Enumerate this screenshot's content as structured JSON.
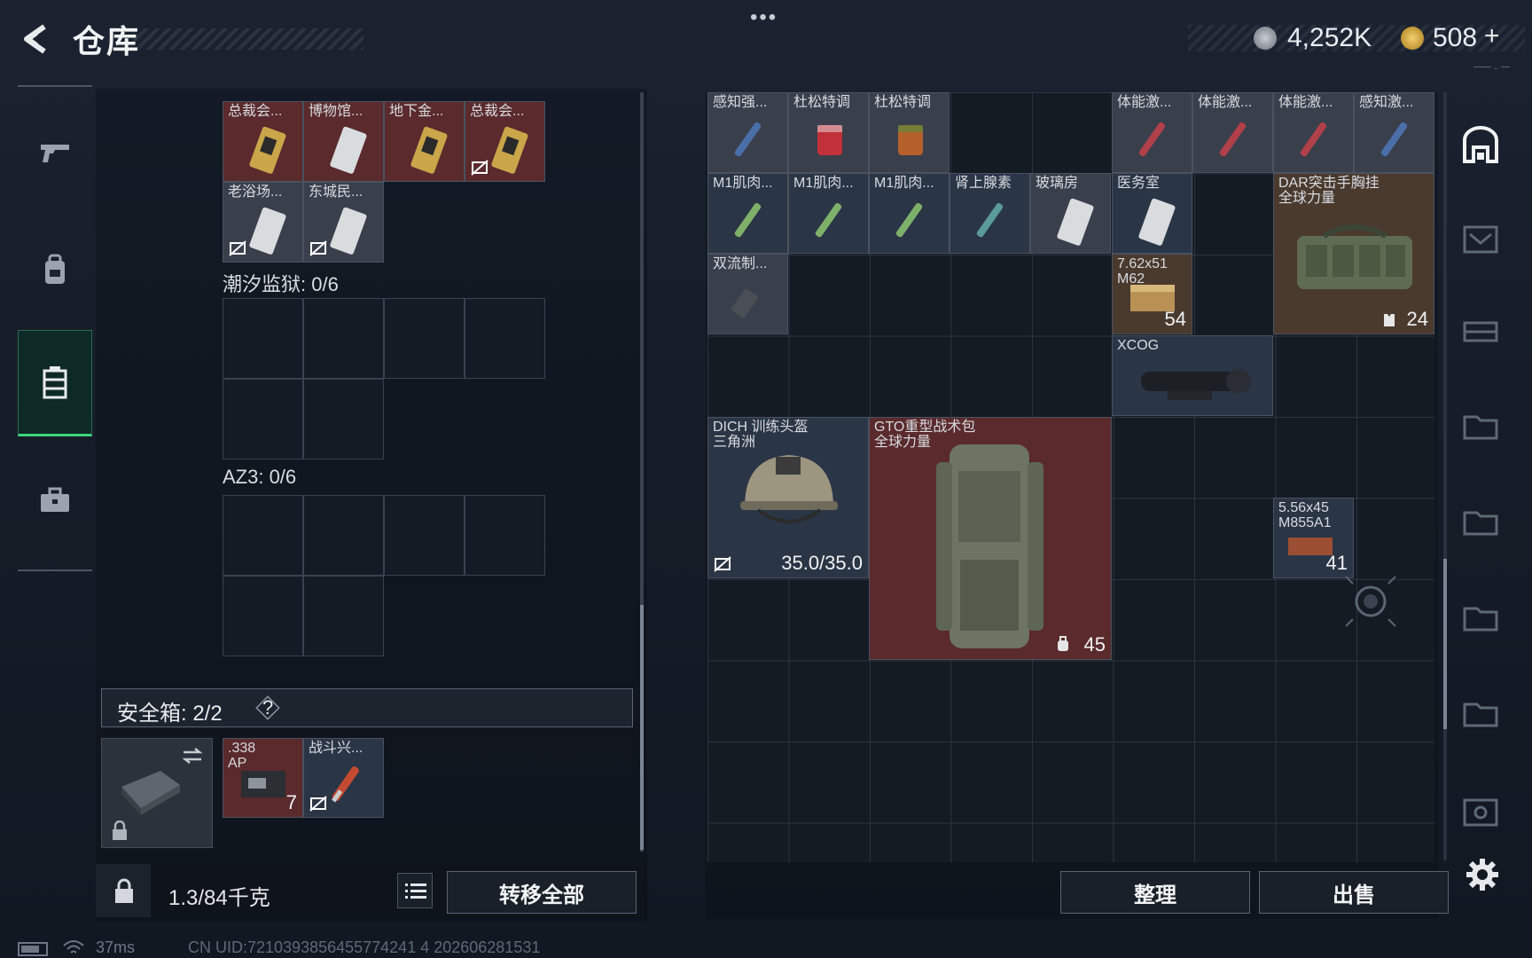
{
  "header": {
    "title": "仓库",
    "menu_dots": "•••",
    "currency_silver": "4,252K",
    "currency_gold": "508",
    "gold_add": "+",
    "sub_text": "—— .. —"
  },
  "nav": {
    "items": [
      {
        "name": "weapon",
        "icon": "pistol-icon"
      },
      {
        "name": "backpack",
        "icon": "backpack-icon"
      },
      {
        "name": "storage",
        "icon": "storage-icon",
        "active": true
      },
      {
        "name": "toolbox",
        "icon": "briefcase-icon"
      }
    ]
  },
  "left_panel": {
    "keys_row1": [
      {
        "label": "总裁会...",
        "color": "red",
        "no_trade": false
      },
      {
        "label": "博物馆...",
        "color": "red",
        "no_trade": false
      },
      {
        "label": "地下金...",
        "color": "red",
        "no_trade": false
      },
      {
        "label": "总裁会...",
        "color": "red",
        "no_trade": true
      }
    ],
    "keys_row2": [
      {
        "label": "老浴场...",
        "color": "gray",
        "no_trade": true
      },
      {
        "label": "东城民...",
        "color": "gray",
        "no_trade": true
      }
    ],
    "section_tide": "潮汐监狱: 0/6",
    "section_az3": "AZ3: 0/6",
    "safe_box_label": "安全箱: 2/2",
    "safe_box_help": "?",
    "safe_items": [
      {
        "label": ".338\nAP",
        "count": "7",
        "color": "red"
      },
      {
        "label": "战斗兴...",
        "count": "",
        "color": "blue",
        "no_trade": true
      }
    ],
    "weight": "1.3/84千克",
    "transfer_all": "转移全部"
  },
  "right_panel": {
    "items": [
      {
        "label": "感知强...",
        "color": "gray"
      },
      {
        "label": "杜松特调",
        "color": "gray"
      },
      {
        "label": "杜松特调",
        "color": "gray"
      },
      {
        "label": "体能激...",
        "color": "gray"
      },
      {
        "label": "体能激...",
        "color": "gray"
      },
      {
        "label": "体能激...",
        "color": "gray"
      },
      {
        "label": "感知激...",
        "color": "gray"
      },
      {
        "label": "M1肌肉...",
        "color": "blue"
      },
      {
        "label": "M1肌肉...",
        "color": "blue"
      },
      {
        "label": "M1肌肉...",
        "color": "blue"
      },
      {
        "label": "肾上腺素",
        "color": "blue"
      },
      {
        "label": "玻璃房",
        "color": "gray"
      },
      {
        "label": "医务室",
        "color": "blue"
      },
      {
        "label": "DAR突击手胸挂\n全球力量",
        "color": "brown",
        "count": "24"
      },
      {
        "label": "双流制...",
        "color": "gray"
      },
      {
        "label": "7.62x51\nM62",
        "color": "brown",
        "count": "54"
      },
      {
        "label": "XCOG",
        "color": "blue"
      },
      {
        "label": "DICH 训练头盔\n三角洲",
        "color": "blue",
        "count": "35.0/35.0",
        "no_trade": true
      },
      {
        "label": "GTO重型战术包\n全球力量",
        "color": "red",
        "count": "45"
      },
      {
        "label": "5.56x45\nM855A1",
        "color": "blue",
        "count": "41"
      }
    ],
    "sort_button": "整理",
    "sell_button": "出售"
  },
  "status_bar": {
    "ping": "37ms",
    "uid": "CN UID:7210393856455774241 4 202606281531"
  },
  "colors": {
    "accent_green": "#3fd47c",
    "item_red": "#5a2a2c",
    "item_blue": "#2a3546",
    "item_brown": "#4a3a2e",
    "item_gray": "#3a3f4c"
  }
}
